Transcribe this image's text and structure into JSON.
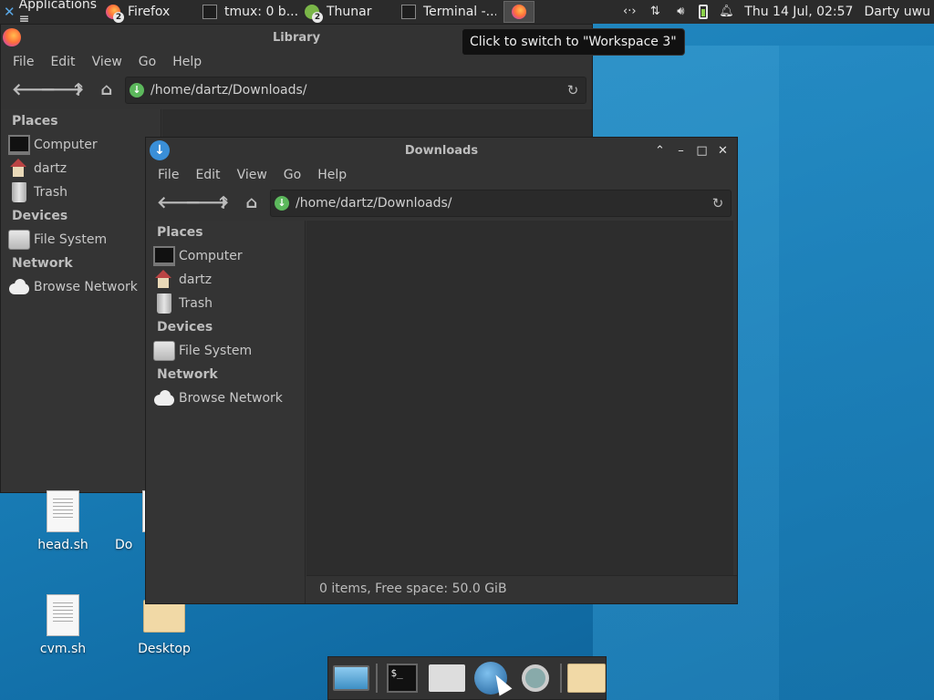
{
  "panel": {
    "applications_label": "Applications ≡",
    "tasks": [
      {
        "label": "Firefox",
        "badge": "2",
        "icon": "firefox-icon"
      },
      {
        "label": "tmux: 0 b...",
        "icon": "terminal-icon"
      },
      {
        "label": "Thunar",
        "badge": "2",
        "icon": "thunar-icon"
      },
      {
        "label": "Terminal -...",
        "icon": "terminal-icon"
      }
    ],
    "clock": "Thu 14 Jul, 02:57",
    "user": "Darty uwu"
  },
  "tooltip": "Click to switch to \"Workspace 3\"",
  "library_window": {
    "title": "Library",
    "menu": [
      "File",
      "Edit",
      "View",
      "Go",
      "Help"
    ],
    "path": "/home/dartz/Downloads/",
    "sidebar": {
      "places_header": "Places",
      "places": [
        "Computer",
        "dartz",
        "Trash"
      ],
      "devices_header": "Devices",
      "devices": [
        "File System"
      ],
      "network_header": "Network",
      "network": [
        "Browse Network"
      ]
    }
  },
  "downloads_window": {
    "title": "Downloads",
    "menu": [
      "File",
      "Edit",
      "View",
      "Go",
      "Help"
    ],
    "path": "/home/dartz/Downloads/",
    "sidebar": {
      "places_header": "Places",
      "places": [
        "Computer",
        "dartz",
        "Trash"
      ],
      "devices_header": "Devices",
      "devices": [
        "File System"
      ],
      "network_header": "Network",
      "network": [
        "Browse Network"
      ]
    },
    "status": "0 items, Free space: 50.0 GiB"
  },
  "desktop_icons": [
    "head.sh",
    "Do",
    "cvm.sh",
    "Desktop"
  ]
}
